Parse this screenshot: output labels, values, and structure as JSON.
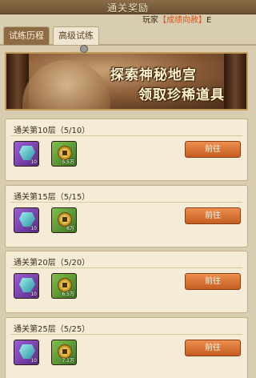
{
  "header": {
    "title": "通关奖励"
  },
  "marquee": {
    "prefix": "玩家",
    "highlight": "【成绩向赦】",
    "suffix": "E"
  },
  "tabs": [
    {
      "label": "试练历程"
    },
    {
      "label": "高级试练"
    }
  ],
  "banner": {
    "line1": "探索神秘地宫",
    "line2": "领取珍稀道具"
  },
  "rewards": [
    {
      "title": "通关第10层（5/10）",
      "gem_qty": "10",
      "coin_qty": "5.5万",
      "button": "前往"
    },
    {
      "title": "通关第15层（5/15）",
      "gem_qty": "10",
      "coin_qty": "6万",
      "button": "前往"
    },
    {
      "title": "通关第20层（5/20）",
      "gem_qty": "10",
      "coin_qty": "6.5万",
      "button": "前往"
    },
    {
      "title": "通关第25层（5/25）",
      "gem_qty": "10",
      "coin_qty": "7.1万",
      "button": "前往"
    }
  ]
}
